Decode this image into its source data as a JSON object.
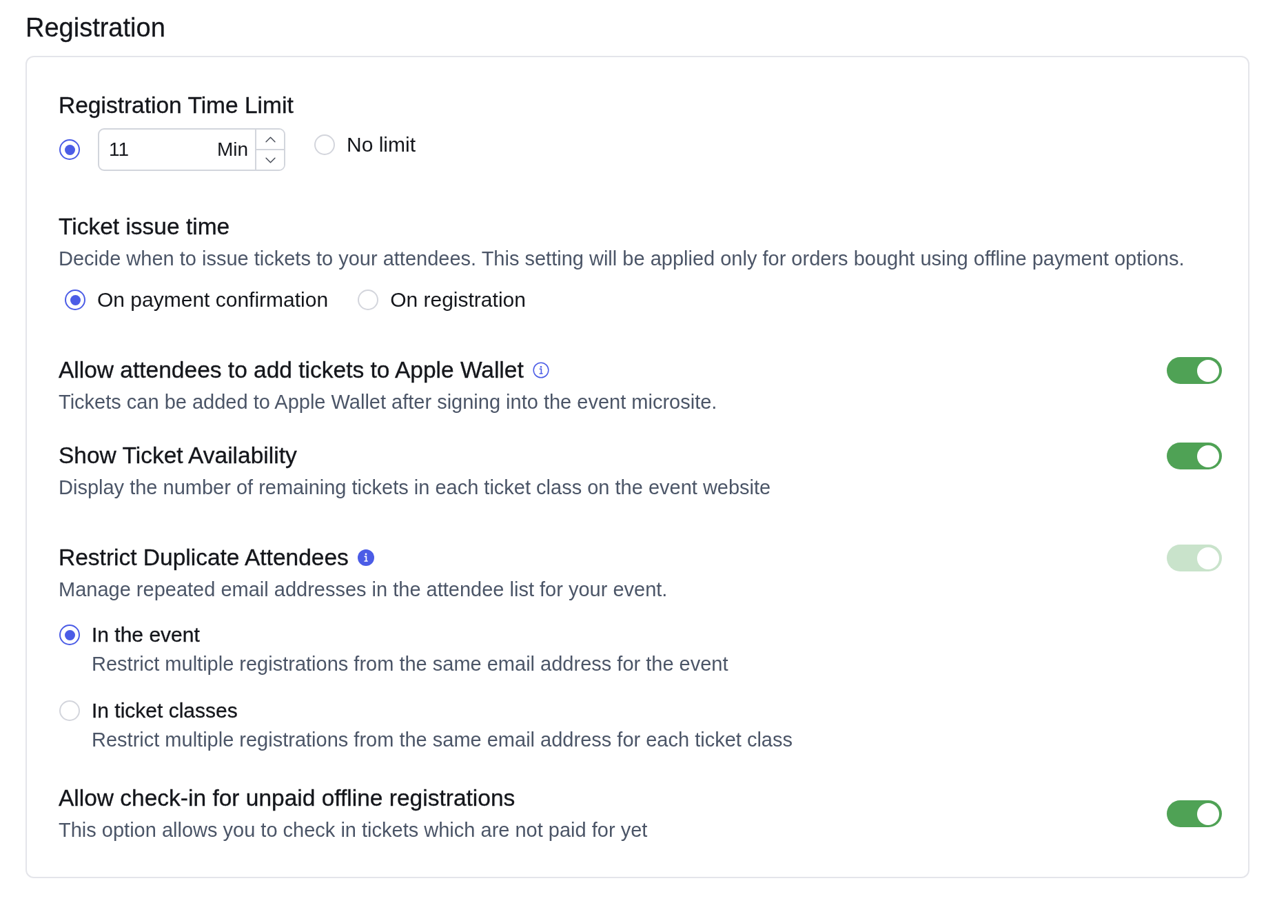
{
  "page_title": "Registration",
  "time_limit": {
    "title": "Registration Time Limit",
    "options": [
      {
        "kind": "number",
        "selected": true,
        "value": "11",
        "unit": "Min"
      },
      {
        "kind": "label",
        "selected": false,
        "label": "No limit"
      }
    ]
  },
  "ticket_issue": {
    "title": "Ticket issue time",
    "description": "Decide when to issue tickets to your attendees. This setting will be applied only for orders bought using offline payment options.",
    "options": [
      {
        "label": "On payment confirmation",
        "selected": true
      },
      {
        "label": "On registration",
        "selected": false
      }
    ]
  },
  "settings": [
    {
      "title": "Allow attendees to add tickets to Apple Wallet",
      "info_icon": true,
      "info_filled": false,
      "description": "Tickets can be added to Apple Wallet after signing into the event microsite.",
      "on": true,
      "disabled": false
    },
    {
      "title": "Show Ticket Availability",
      "description": "Display the number of remaining tickets in each ticket class on the event website",
      "on": true,
      "disabled": false
    },
    {
      "title": "Restrict Duplicate Attendees",
      "info_icon": true,
      "info_filled": true,
      "description": "Manage repeated email addresses in the attendee list for your event.",
      "on": true,
      "disabled": true,
      "options": [
        {
          "label": "In the event",
          "description": "Restrict multiple registrations from the same email address for the event",
          "selected": true
        },
        {
          "label": "In ticket classes",
          "description": "Restrict multiple registrations from the same email address for each ticket class",
          "selected": false
        }
      ]
    },
    {
      "title": "Allow check-in for unpaid offline registrations",
      "description": "This option allows you to check in tickets which are not paid for yet",
      "on": true,
      "disabled": false
    }
  ]
}
